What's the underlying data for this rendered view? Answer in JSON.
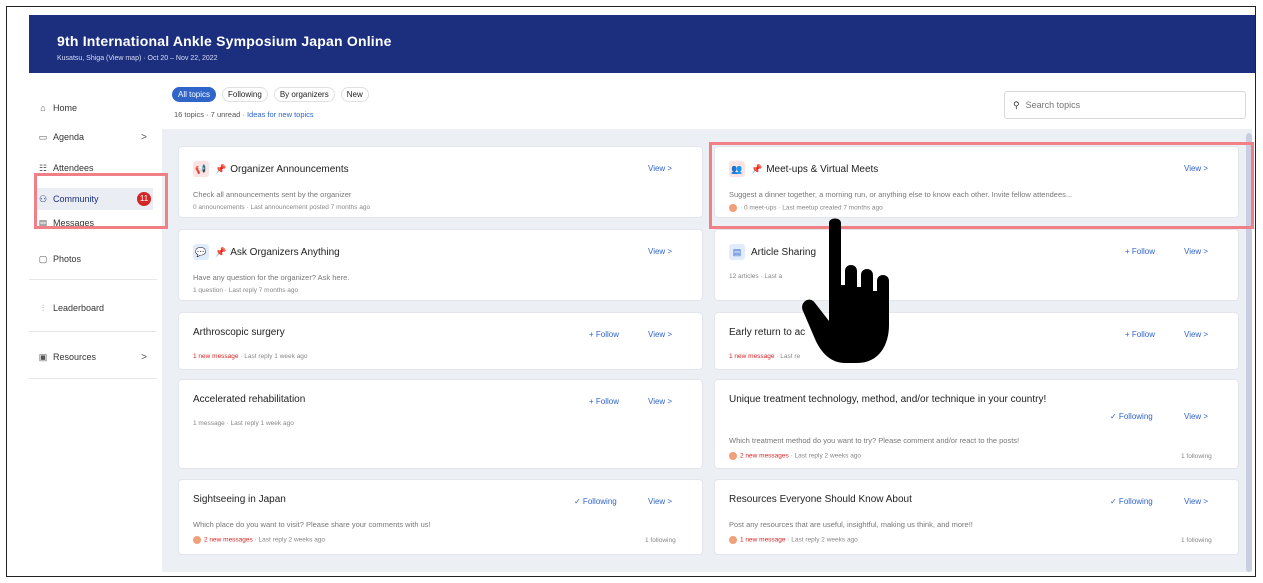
{
  "header": {
    "title": "9th International Ankle Symposium Japan Online",
    "subtitle": "Kusatsu, Shiga (View map) · Oct 20 – Nov 22, 2022"
  },
  "sidebar": {
    "items": [
      {
        "label": "Home",
        "icon": "home-icon"
      },
      {
        "label": "Agenda",
        "icon": "calendar-icon",
        "chevron": ">"
      },
      {
        "label": "Attendees",
        "icon": "people-icon"
      },
      {
        "label": "Community",
        "icon": "community-icon",
        "badge": "11"
      },
      {
        "label": "Messages",
        "icon": "message-icon"
      },
      {
        "label": "Photos",
        "icon": "photo-icon"
      },
      {
        "label": "Leaderboard",
        "icon": "leaderboard-icon"
      },
      {
        "label": "Resources",
        "icon": "folder-icon",
        "chevron": ">"
      }
    ]
  },
  "tabs": [
    "All topics",
    "Following",
    "By organizers",
    "New"
  ],
  "topics_meta": {
    "count": "16 topics · 7 unread ·",
    "link": "Ideas for new topics"
  },
  "search": {
    "placeholder": "Search topics"
  },
  "cards": [
    {
      "title": "Organizer Announcements",
      "desc": "Check all announcements sent by the organizer",
      "meta": "0 announcements · Last announcement posted 7 months ago",
      "view": "View >"
    },
    {
      "title": "Meet-ups & Virtual Meets",
      "desc": "Suggest a dinner together, a morning run, or anything else to know each other. Invite fellow attendees...",
      "meta": "· 0 meet-ups · Last meetup created 7 months ago",
      "view": "View >"
    },
    {
      "title": "Ask Organizers Anything",
      "desc": "Have any question for the organizer? Ask here.",
      "meta": "1 question · Last reply 7 months ago",
      "view": "View >"
    },
    {
      "title": "Article Sharing",
      "meta": "12 articles · Last a",
      "follow": "+ Follow",
      "view": "View >"
    },
    {
      "title": "Arthroscopic surgery",
      "meta_new": "1 new message",
      "meta": " · Last reply 1 week ago",
      "follow": "+ Follow",
      "view": "View >"
    },
    {
      "title": "Early return to ac",
      "meta_new": "1 new message",
      "meta": " · Last re",
      "follow": "+ Follow",
      "view": "View >"
    },
    {
      "title": "Accelerated rehabilitation",
      "meta": "1 message · Last reply 1 week ago",
      "follow": "+ Follow",
      "view": "View >"
    },
    {
      "title": "Unique treatment technology, method, and/or technique in your country!",
      "desc": "Which treatment method do you want to try? Please comment and/or react to the posts!",
      "meta_new": "2 new messages",
      "meta": " · Last reply 2 weeks ago",
      "following": "✓ Following",
      "view": "View >",
      "followers": "1 following"
    },
    {
      "title": "Sightseeing in Japan",
      "desc": "Which place do you want to visit? Please share your comments with us!",
      "meta_new": "2 new messages",
      "meta": " · Last reply 2 weeks ago",
      "following": "✓ Following",
      "view": "View >",
      "followers": "1 following"
    },
    {
      "title": "Resources Everyone Should Know About",
      "desc": "Post any resources that are useful, insightful, making us think, and more!!",
      "meta_new": "1 new message",
      "meta": " · Last reply 2 weeks ago",
      "following": "✓ Following",
      "view": "View >",
      "followers": "1 following"
    }
  ],
  "colors": {
    "header": "#1c2f7f",
    "accent": "#2f64c9",
    "highlight": "#f07f86",
    "badge": "#d32626"
  }
}
